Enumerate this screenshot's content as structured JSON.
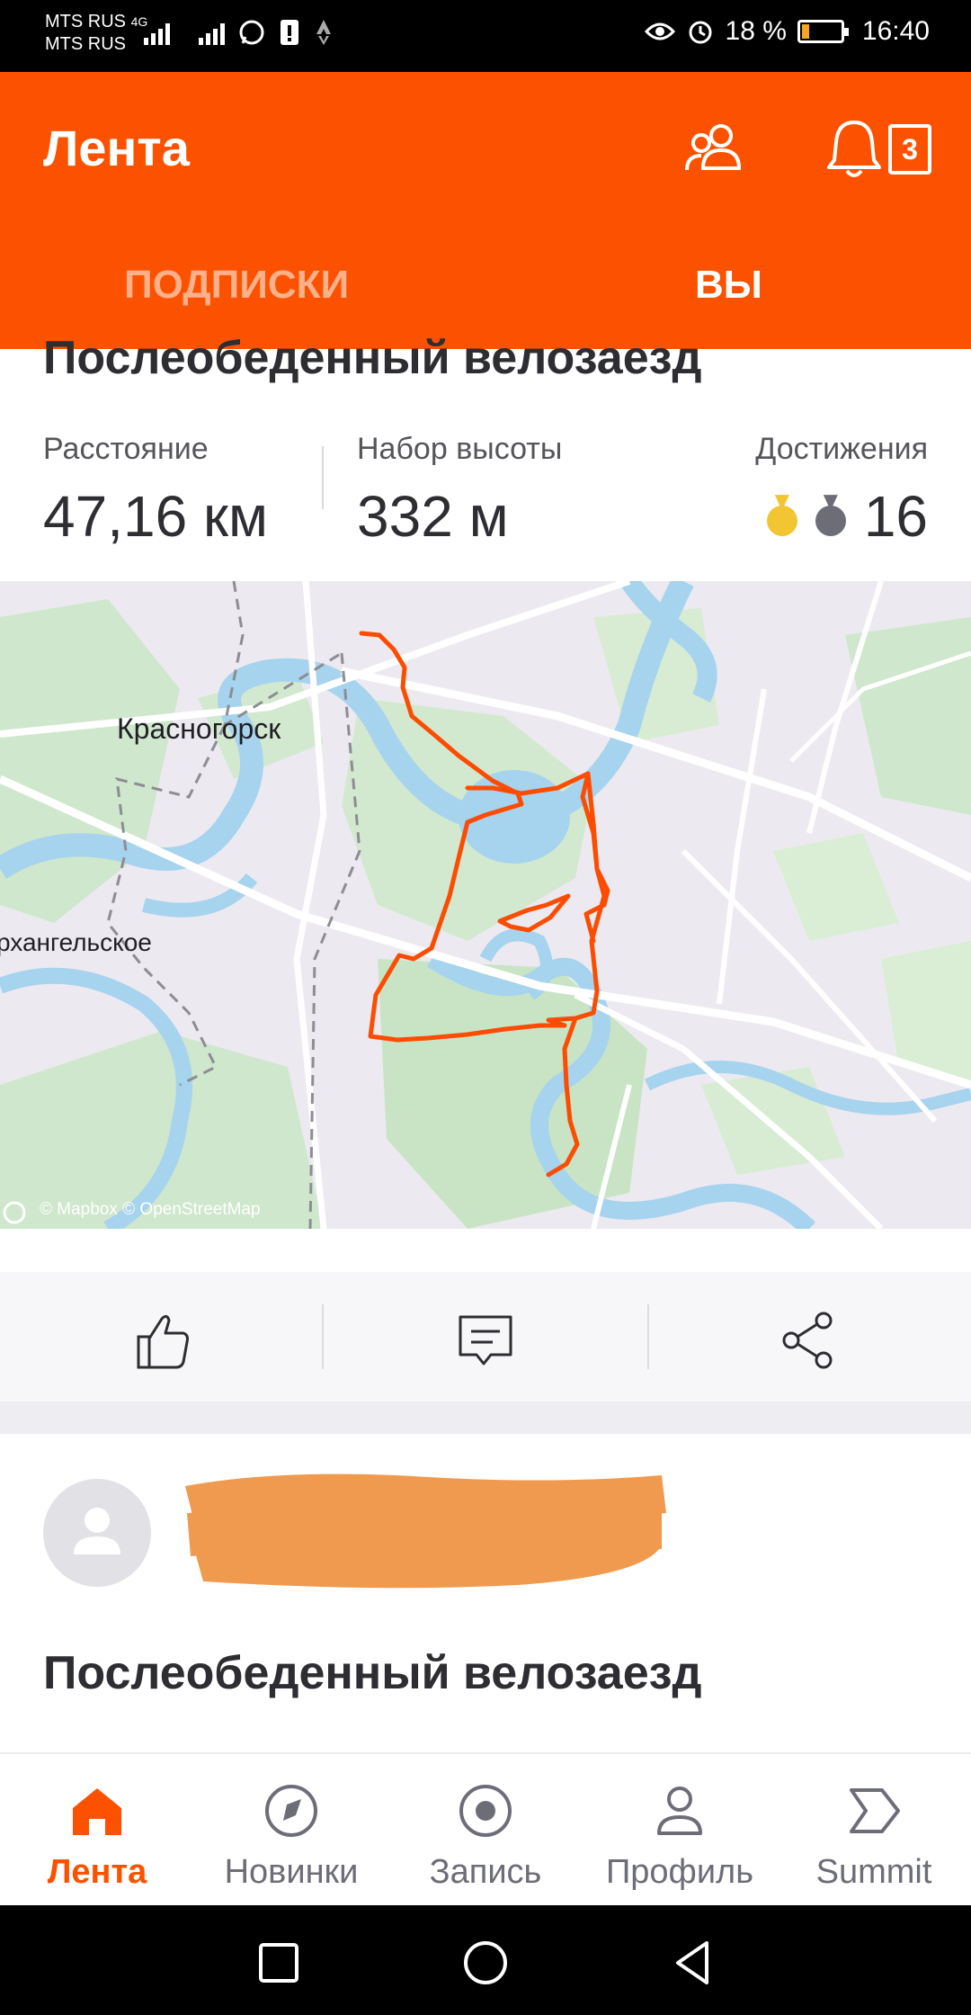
{
  "status_bar": {
    "carrier_1": "MTS RUS",
    "carrier_2": "MTS RUS",
    "network": "4G",
    "battery_percent": "18 %",
    "battery_level": 0.18,
    "time": "16:40",
    "icons": [
      "signal-icon",
      "whatsapp-icon",
      "sim-alert-icon",
      "strava-icon",
      "eye-icon",
      "alarm-icon",
      "battery-icon"
    ]
  },
  "header": {
    "title": "Лента",
    "notifications_count": "3",
    "tabs": [
      {
        "label": "ПОДПИСКИ",
        "active": false
      },
      {
        "label": "ВЫ",
        "active": true
      }
    ],
    "accent_color": "#fc5200"
  },
  "activity_1": {
    "title": "Послеобеденный велозаезд",
    "stats": {
      "distance_label": "Расстояние",
      "distance_value": "47,16 км",
      "elevation_label": "Набор высоты",
      "elevation_value": "332 м",
      "achievements_label": "Достижения",
      "achievements_value": "16"
    },
    "map": {
      "labels": [
        "Красногорск",
        "рхангельское"
      ],
      "credit": "© Mapbox © OpenStreetMap",
      "route_color": "#fc4c02"
    }
  },
  "actions": [
    "like-icon",
    "comment-icon",
    "share-icon"
  ],
  "activity_2": {
    "title": "Послеобеденный велозаезд"
  },
  "bottom_nav": [
    {
      "label": "Лента",
      "icon": "home-icon",
      "active": true
    },
    {
      "label": "Новинки",
      "icon": "compass-icon",
      "active": false
    },
    {
      "label": "Запись",
      "icon": "record-icon",
      "active": false
    },
    {
      "label": "Профиль",
      "icon": "profile-icon",
      "active": false
    },
    {
      "label": "Summit",
      "icon": "summit-icon",
      "active": false
    }
  ]
}
